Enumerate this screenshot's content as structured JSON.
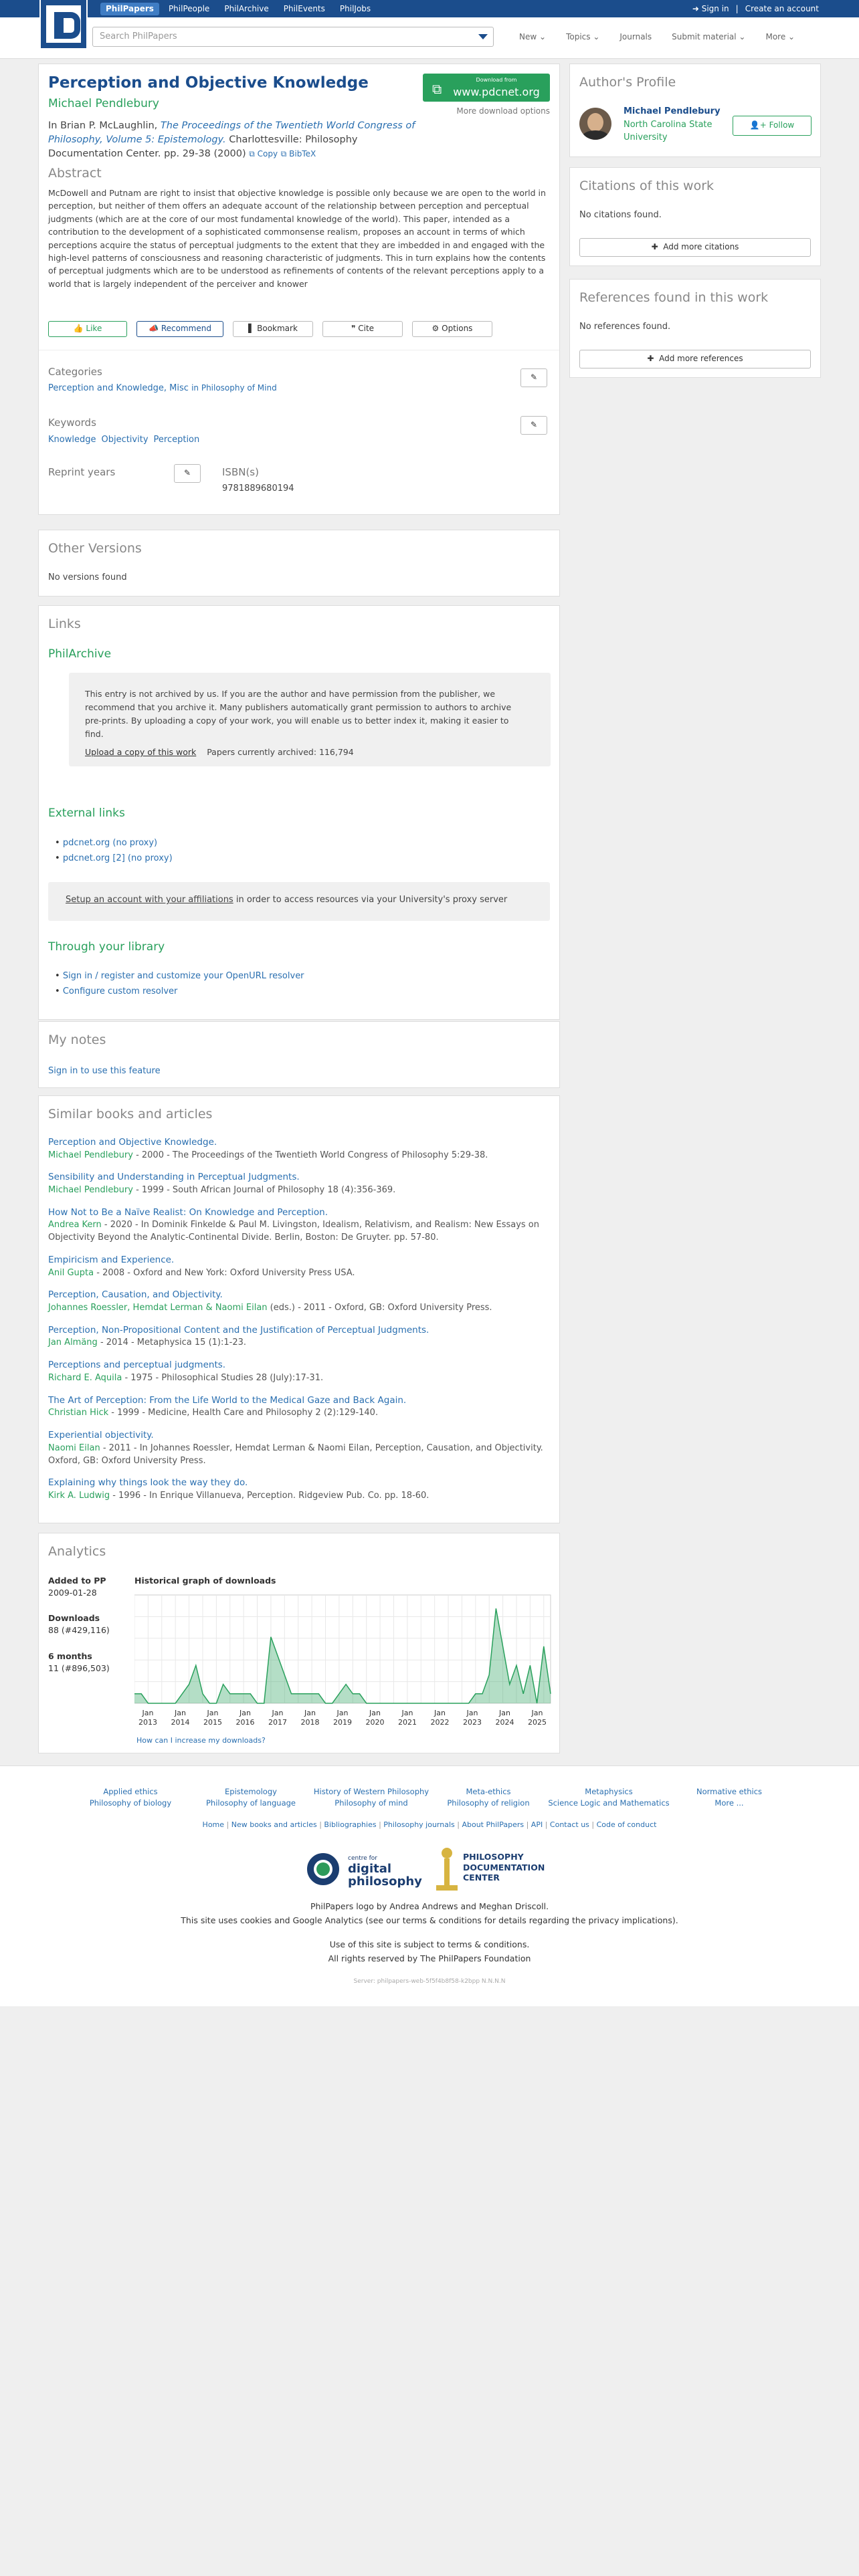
{
  "topnav": {
    "items": [
      "PhilPapers",
      "PhilPeople",
      "PhilArchive",
      "PhilEvents",
      "PhilJobs"
    ],
    "signin": "Sign in",
    "create": "Create an account"
  },
  "search": {
    "placeholder": "Search PhilPapers"
  },
  "subnav": {
    "items": [
      "New",
      "Topics",
      "Journals",
      "Submit material",
      "More"
    ]
  },
  "paper": {
    "title": "Perception and Objective Knowledge",
    "author": "Michael Pendlebury",
    "citation_prefix": "In Brian P. McLaughlin,",
    "citation_book": "The Proceedings of the Twentieth World Congress of Philosophy, Volume 5: Epistemology.",
    "citation_rest": "Charlottesville: Philosophy Documentation Center. pp. 29-38 (2000)",
    "copy": "Copy",
    "bibtex": "BibTeX",
    "download_small": "Download from",
    "download_site": "www.pdcnet.org",
    "more_downloads": "More download options",
    "abstract_title": "Abstract",
    "abstract": "McDowell and Putnam are right to insist that objective knowledge is possible only because we are open to the world in perception, but neither of them offers an adequate account of the relationship between perception and perceptual judgments (which are at the core of our most fundamental knowledge of the world). This paper, intended as a contribution to the development of a sophisticated commonsense realism, proposes an account in terms of which perceptions acquire the status of perceptual judgments to the extent that they are imbedded in and engaged with the high-level patterns of consciousness and reasoning characteristic of judgments. This in turn explains how the contents of perceptual judgments which are to be understood as refinements of contents of the relevant perceptions apply to a world that is largely independent of the perceiver and knower",
    "actions": [
      "Like",
      "Recommend",
      "Bookmark",
      "Cite",
      "Options"
    ],
    "categories_title": "Categories",
    "category": "Perception and Knowledge, Misc",
    "category_in": "in Philosophy of Mind",
    "keywords_title": "Keywords",
    "keywords": [
      "Knowledge",
      "Objectivity",
      "Perception"
    ],
    "reprint_title": "Reprint years",
    "isbn_title": "ISBN(s)",
    "isbn": "9781889680194"
  },
  "other_versions": {
    "title": "Other Versions",
    "text": "No versions found"
  },
  "links": {
    "title": "Links",
    "philarchive": "PhilArchive",
    "archive_note": "This entry is not archived by us. If you are the author and have permission from the publisher, we recommend that you archive it. Many publishers automatically grant permission to authors to archive pre-prints. By uploading a copy of your work, you will enable us to better index it, making it easier to find.",
    "upload": "Upload a copy of this work",
    "archived": "Papers currently archived: 116,794",
    "external_title": "External links",
    "external": [
      "pdcnet.org (no proxy)",
      "pdcnet.org [2] (no proxy)"
    ],
    "proxy_link": "Setup an account with your affiliations",
    "proxy_rest": "in order to access resources via your University's proxy server",
    "library_title": "Through your library",
    "library": [
      "Sign in / register and customize your OpenURL resolver",
      "Configure custom resolver"
    ]
  },
  "notes": {
    "title": "My notes",
    "signin": "Sign in to use this feature"
  },
  "similar": {
    "title": "Similar books and articles",
    "items": [
      {
        "t": "Perception and Objective Knowledge.",
        "a": "Michael Pendlebury",
        "rest": " - 2000 - The Proceedings of the Twentieth World Congress of Philosophy 5:29-38."
      },
      {
        "t": "Sensibility and Understanding in Perceptual Judgments.",
        "a": "Michael Pendlebury",
        "rest": " - 1999 - South African Journal of Philosophy 18 (4):356-369."
      },
      {
        "t": "How Not to Be a Naïve Realist: On Knowledge and Perception.",
        "a": "Andrea Kern",
        "rest": " - 2020 - In Dominik Finkelde & Paul M. Livingston, Idealism, Relativism, and Realism: New Essays on Objectivity Beyond the Analytic-Continental Divide. Berlin, Boston: De Gruyter. pp. 57-80."
      },
      {
        "t": "Empiricism and Experience.",
        "a": "Anil Gupta",
        "rest": " - 2008 - Oxford and New York: Oxford University Press USA."
      },
      {
        "t": "Perception, Causation, and Objectivity.",
        "a": "Johannes Roessler, Hemdat Lerman & Naomi Eilan",
        "rest": " (eds.) - 2011 - Oxford, GB: Oxford University Press."
      },
      {
        "t": "Perception, Non-Propositional Content and the Justification of Perceptual Judgments.",
        "a": "Jan Almäng",
        "rest": " - 2014 - Metaphysica 15 (1):1-23."
      },
      {
        "t": "Perceptions and perceptual judgments.",
        "a": "Richard E. Aquila",
        "rest": " - 1975 - Philosophical Studies 28 (July):17-31."
      },
      {
        "t": "The Art of Perception: From the Life World to the Medical Gaze and Back Again.",
        "a": "Christian Hick",
        "rest": " - 1999 - Medicine, Health Care and Philosophy 2 (2):129-140."
      },
      {
        "t": "Experiential objectivity.",
        "a": "Naomi Eilan",
        "rest": " - 2011 - In Johannes Roessler, Hemdat Lerman & Naomi Eilan, Perception, Causation, and Objectivity. Oxford, GB: Oxford University Press."
      },
      {
        "t": "Explaining why things look the way they do.",
        "a": "Kirk A. Ludwig",
        "rest": " - 1996 - In Enrique Villanueva, Perception. Ridgeview Pub. Co. pp. 18-60."
      }
    ]
  },
  "analytics": {
    "title": "Analytics",
    "added_label": "Added to PP",
    "added": "2009-01-28",
    "downloads_label": "Downloads",
    "downloads": "88 (#429,116)",
    "months_label": "6 months",
    "months": "11 (#896,503)",
    "graph_title": "Historical graph of downloads",
    "help": "How can I increase my downloads?"
  },
  "chart_data": {
    "type": "area",
    "title": "Historical graph of downloads",
    "x": [
      "Jan 2013",
      "Jan 2014",
      "Jan 2015",
      "Jan 2016",
      "Jan 2017",
      "Jan 2018",
      "Jan 2019",
      "Jan 2020",
      "Jan 2021",
      "Jan 2022",
      "Jan 2023",
      "Jan 2024",
      "Jan 2025"
    ],
    "values": [
      1,
      1,
      0,
      0,
      0,
      0,
      0,
      1,
      2,
      4,
      1,
      0,
      0,
      2,
      1,
      1,
      1,
      1,
      0,
      0,
      7,
      5,
      3,
      1,
      1,
      1,
      1,
      1,
      0,
      0,
      1,
      2,
      1,
      1,
      0,
      0,
      0,
      0,
      0,
      0,
      0,
      0,
      0,
      0,
      0,
      0,
      0,
      0,
      0,
      0,
      1,
      1,
      3,
      10,
      6,
      2,
      4,
      1,
      4,
      0,
      6,
      1
    ],
    "ylim": [
      0,
      11
    ],
    "color": "#29a05c"
  },
  "profile": {
    "title": "Author's Profile",
    "name": "Michael Pendlebury",
    "affiliation": "North Carolina State University",
    "follow": "Follow"
  },
  "citations": {
    "title": "Citations of this work",
    "text": "No citations found.",
    "add": "Add more citations"
  },
  "references": {
    "title": "References found in this work",
    "text": "No references found.",
    "add": "Add more references"
  },
  "footer": {
    "cols": [
      [
        "Applied ethics",
        "Philosophy of biology"
      ],
      [
        "Epistemology",
        "Philosophy of language"
      ],
      [
        "History of Western Philosophy",
        "Philosophy of mind"
      ],
      [
        "Meta-ethics",
        "Philosophy of religion"
      ],
      [
        "Metaphysics",
        "Science Logic and Mathematics"
      ],
      [
        "Normative ethics",
        "More ..."
      ]
    ],
    "links": [
      "Home",
      "New books and articles",
      "Bibliographies",
      "Philosophy journals",
      "About PhilPapers",
      "API",
      "Contact us",
      "Code of conduct"
    ],
    "logo_line": "PhilPapers logo by Andrea Andrews and Meghan Driscoll.",
    "cookies": "This site uses cookies and Google Analytics (see our terms & conditions for details regarding the privacy implications).",
    "terms": "Use of this site is subject to terms & conditions.",
    "rights": "All rights reserved by The PhilPapers Foundation",
    "server": "Server: philpapers-web-5f5f4b8f58-k2bpp N.N.N.N",
    "logo1_small": "centre for",
    "logo1_big": "digital philosophy",
    "logo2": "PHILOSOPHY DOCUMENTATION CENTER"
  }
}
